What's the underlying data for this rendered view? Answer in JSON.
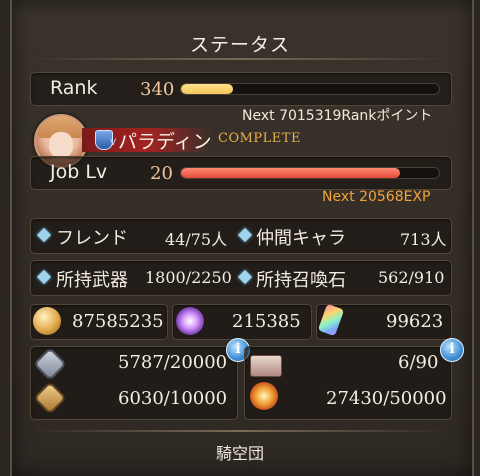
{
  "header": {
    "title": "ステータス"
  },
  "rank": {
    "label": "Rank",
    "value": "340",
    "progress": 0.2,
    "next_text": "Next 7015319Rankポイント"
  },
  "job": {
    "name": "パラディン",
    "badge": "V",
    "status": "COMPLETE",
    "label": "Job Lv",
    "value": "20",
    "progress": 0.85,
    "next_text": "Next 20568EXP"
  },
  "stats": [
    {
      "label": "フレンド",
      "value": "44/75人"
    },
    {
      "label": "仲間キャラ",
      "value": "713人"
    },
    {
      "label": "所持武器",
      "value": "1800/2250"
    },
    {
      "label": "所持召喚石",
      "value": "562/910"
    }
  ],
  "currencies": [
    {
      "icon": "rupie-coin-icon",
      "value": "87585235"
    },
    {
      "icon": "crystal-gem-icon",
      "value": "215385"
    },
    {
      "icon": "rainbow-crystal-icon",
      "value": "99623"
    }
  ],
  "left_panel": {
    "info": "i",
    "rows": [
      {
        "icon": "silver-emblem-icon",
        "value": "5787/20000"
      },
      {
        "icon": "gold-emblem-icon",
        "value": "6030/10000"
      }
    ]
  },
  "right_panel": {
    "info": "i",
    "rows": [
      {
        "icon": "ticket-icon",
        "value": "6/90"
      },
      {
        "icon": "star-burst-icon",
        "value": "27430/50000"
      }
    ]
  },
  "footer": {
    "title": "騎空団"
  },
  "colors": {
    "rank_bar": "#f1c75a",
    "job_bar": "#e4493a",
    "accent_orange": "#f2a33b",
    "complete_gold": "#e7b04a"
  }
}
